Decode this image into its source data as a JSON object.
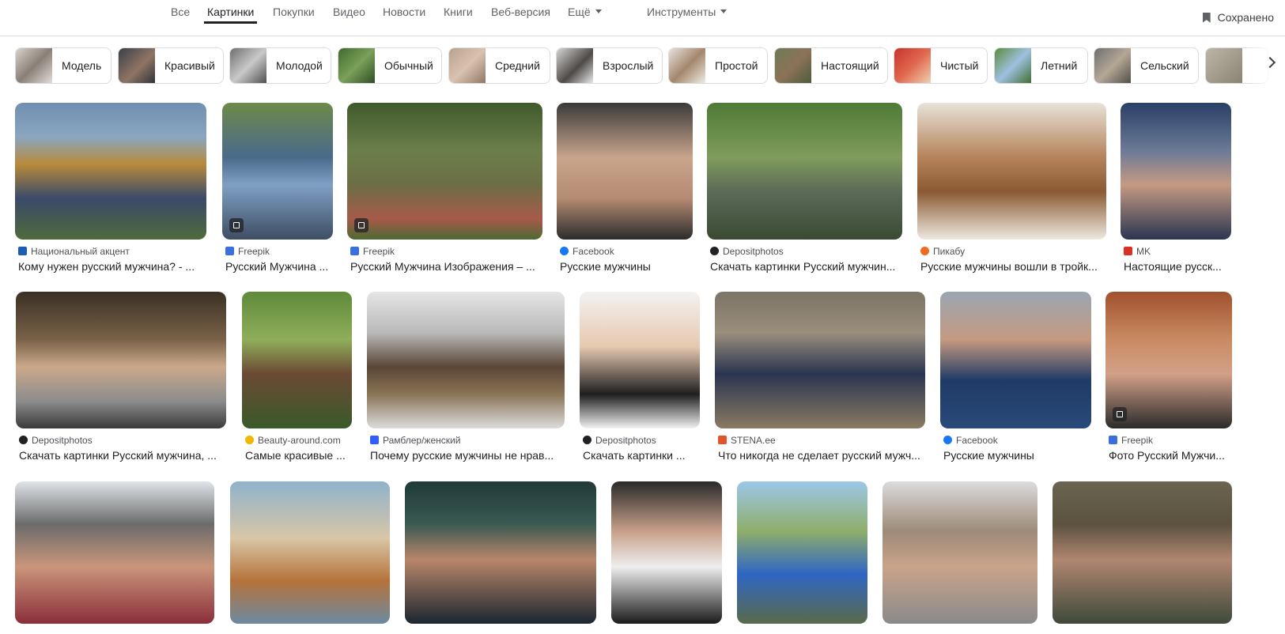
{
  "nav": {
    "tabs": [
      "Все",
      "Картинки",
      "Покупки",
      "Видео",
      "Новости",
      "Книги",
      "Веб-версия",
      "Ещё"
    ],
    "tools": "Инструменты",
    "saved": "Сохранено"
  },
  "chips": [
    "Модель",
    "Красивый",
    "Молодой",
    "Обычный",
    "Средний",
    "Взрослый",
    "Простой",
    "Настоящий",
    "Чистый",
    "Летний",
    "Сельский"
  ],
  "results": [
    {
      "source": "Национальный акцент",
      "title": "Кому нужен русский мужчина? - ..."
    },
    {
      "source": "Freepik",
      "title": "Русский Мужчина ..."
    },
    {
      "source": "Freepik",
      "title": "Русский Мужчина Изображения – ..."
    },
    {
      "source": "Facebook",
      "title": "Русские мужчины"
    },
    {
      "source": "Depositphotos",
      "title": "Скачать картинки Русский мужчин..."
    },
    {
      "source": "Пикабу",
      "title": "Русские мужчины вошли в тройк..."
    },
    {
      "source": "MK",
      "title": "Настоящие русск..."
    },
    {
      "source": "Depositphotos",
      "title": "Скачать картинки Русский мужчина, ..."
    },
    {
      "source": "Beauty-around.com",
      "title": "Самые красивые ..."
    },
    {
      "source": "Рамблер/женский",
      "title": "Почему русские мужчины не нрав..."
    },
    {
      "source": "Depositphotos",
      "title": "Скачать картинки ..."
    },
    {
      "source": "STENA.ee",
      "title": "Что никогда не сделает русский мужч..."
    },
    {
      "source": "Facebook",
      "title": "Русские мужчины"
    },
    {
      "source": "Freepik",
      "title": "Фото Русский Мужчи..."
    },
    {
      "source": "",
      "title": ""
    },
    {
      "source": "",
      "title": ""
    },
    {
      "source": "",
      "title": ""
    },
    {
      "source": "",
      "title": ""
    },
    {
      "source": "",
      "title": ""
    },
    {
      "source": "",
      "title": ""
    },
    {
      "source": "",
      "title": ""
    }
  ]
}
